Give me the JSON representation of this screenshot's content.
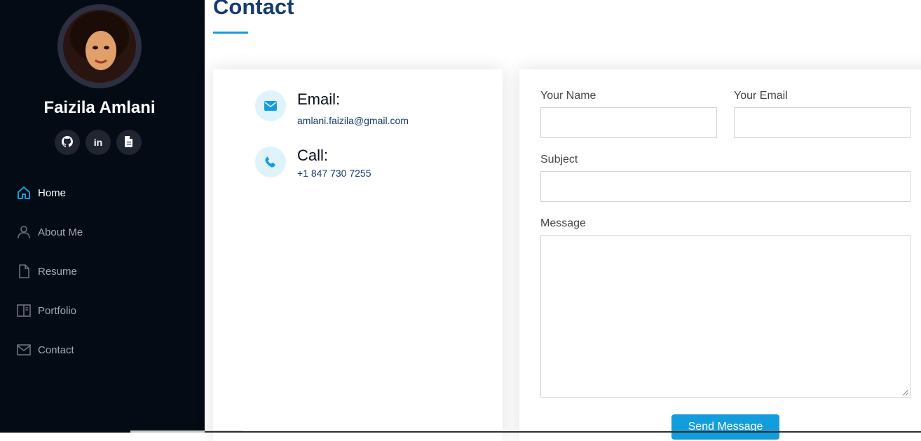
{
  "sidebar": {
    "profile_name": "Faizila Amlani",
    "social": [
      {
        "icon": "github-icon",
        "glyph": ""
      },
      {
        "icon": "linkedin-icon",
        "glyph": "in"
      },
      {
        "icon": "document-icon",
        "glyph": ""
      }
    ],
    "nav": [
      {
        "label": "Home",
        "icon": "home-icon",
        "active": true
      },
      {
        "label": "About Me",
        "icon": "user-icon",
        "active": false
      },
      {
        "label": "Resume",
        "icon": "file-icon",
        "active": false
      },
      {
        "label": "Portfolio",
        "icon": "book-icon",
        "active": false
      },
      {
        "label": "Contact",
        "icon": "envelope-icon",
        "active": false
      }
    ]
  },
  "main": {
    "title": "Contact",
    "info": {
      "email_title": "Email:",
      "email_value": "amlani.faizila@gmail.com",
      "call_title": "Call:",
      "call_value": "+1 847 730 7255"
    },
    "form": {
      "name_label": "Your Name",
      "email_label": "Your Email",
      "subject_label": "Subject",
      "message_label": "Message",
      "submit_label": "Send Message"
    }
  },
  "colors": {
    "sidebar_bg": "#040b14",
    "accent": "#149ddd",
    "title": "#173b6c"
  }
}
